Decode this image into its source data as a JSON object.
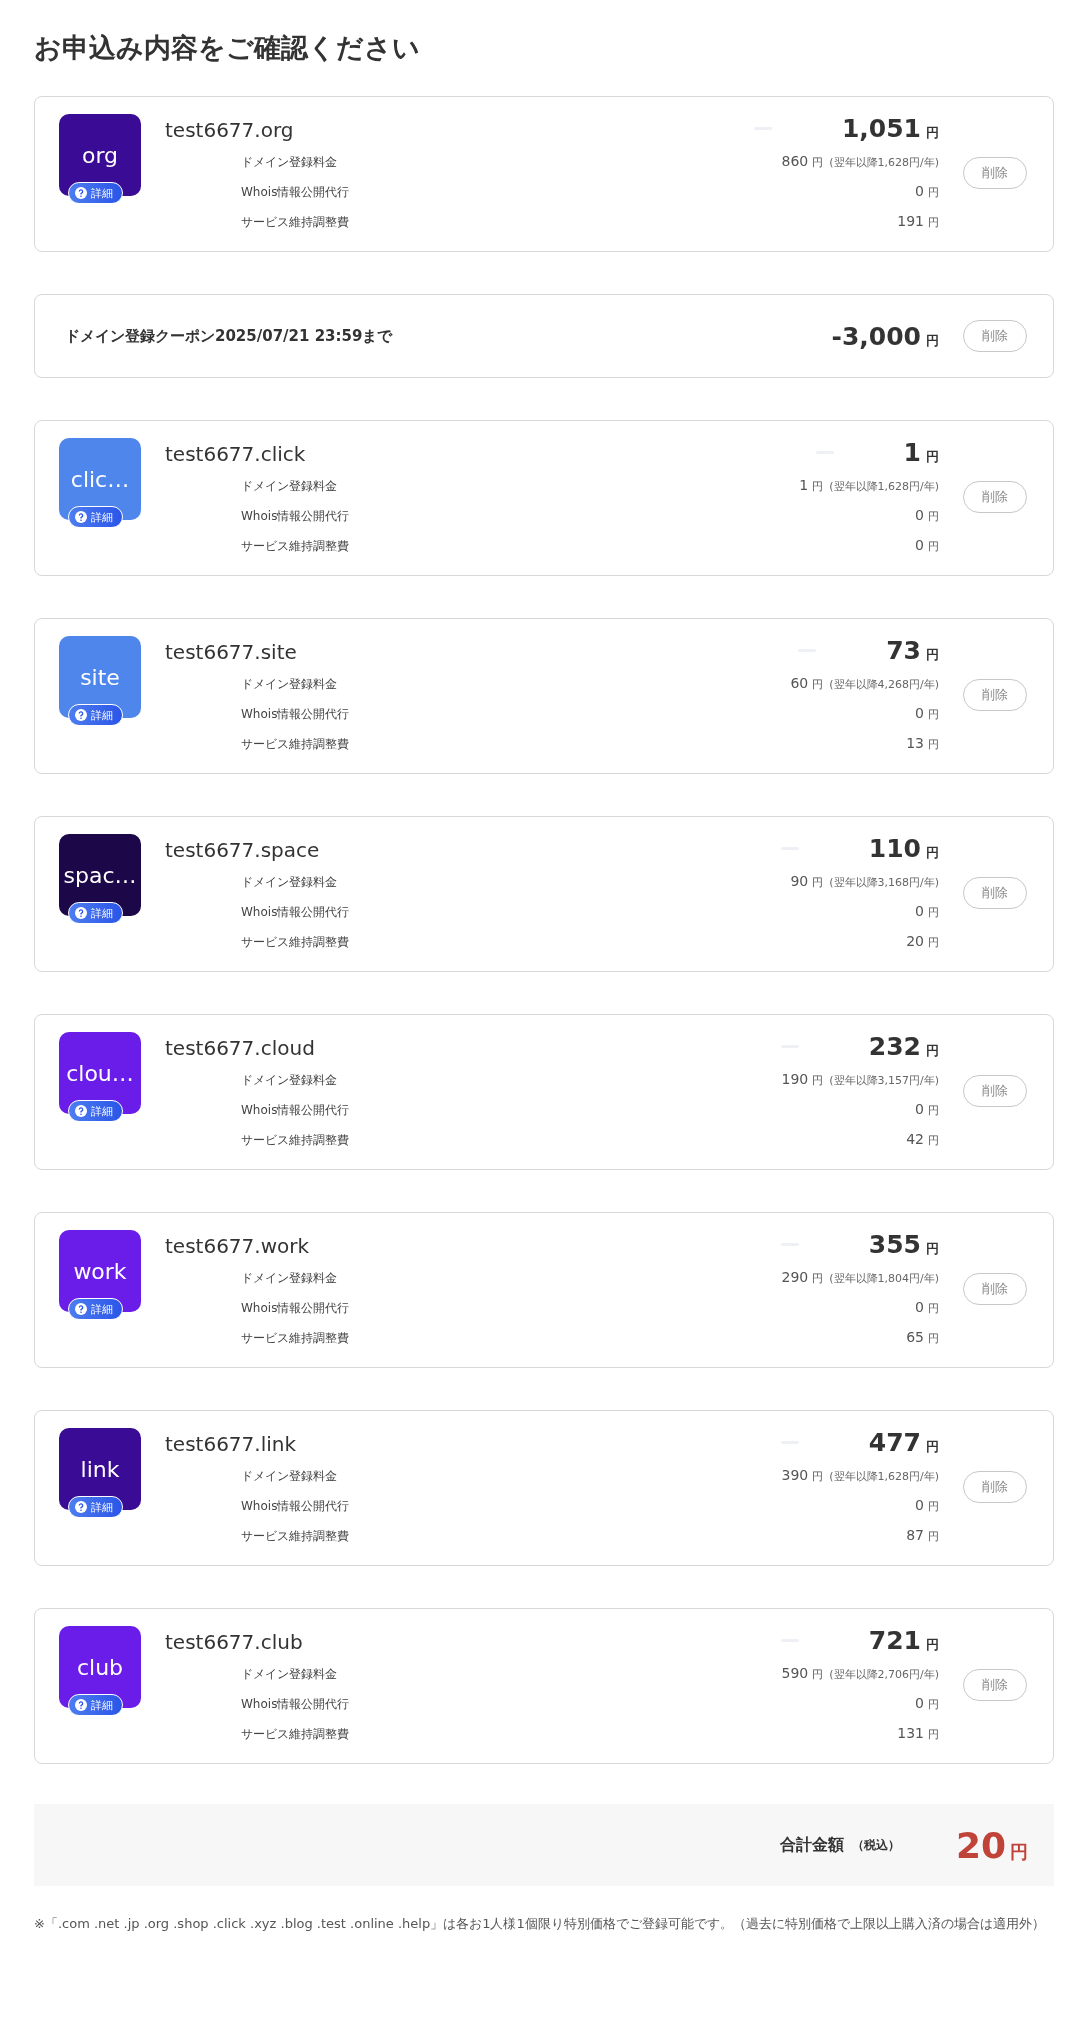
{
  "title": "お申込み内容をご確認ください",
  "items": [
    {
      "kind": "domain",
      "name": "test6677.org",
      "icon_label": "org",
      "color": "#3a0b94",
      "detail_label": "詳細",
      "price": "1,051",
      "unit": "円",
      "delete_label": "削除",
      "rows": [
        {
          "label": "ドメイン登録料金",
          "amount": "860",
          "unit": "円",
          "note": "(翌年以降1,628円/年)"
        },
        {
          "label": "Whois情報公開代行",
          "amount": "0",
          "unit": "円"
        },
        {
          "label": "サービス維持調整費",
          "amount": "191",
          "unit": "円"
        }
      ]
    },
    {
      "kind": "coupon",
      "name": "ドメイン登録クーポン2025/07/21 23:59まで",
      "price": "-3,000",
      "unit": "円",
      "delete_label": "削除"
    },
    {
      "kind": "domain",
      "name": "test6677.click",
      "icon_label": "clic…",
      "color": "#4f86ec",
      "detail_label": "詳細",
      "price": "1",
      "unit": "円",
      "delete_label": "削除",
      "rows": [
        {
          "label": "ドメイン登録料金",
          "amount": "1",
          "unit": "円",
          "note": "(翌年以降1,628円/年)"
        },
        {
          "label": "Whois情報公開代行",
          "amount": "0",
          "unit": "円"
        },
        {
          "label": "サービス維持調整費",
          "amount": "0",
          "unit": "円"
        }
      ]
    },
    {
      "kind": "domain",
      "name": "test6677.site",
      "icon_label": "site",
      "color": "#4f86ec",
      "detail_label": "詳細",
      "price": "73",
      "unit": "円",
      "delete_label": "削除",
      "rows": [
        {
          "label": "ドメイン登録料金",
          "amount": "60",
          "unit": "円",
          "note": "(翌年以降4,268円/年)"
        },
        {
          "label": "Whois情報公開代行",
          "amount": "0",
          "unit": "円"
        },
        {
          "label": "サービス維持調整費",
          "amount": "13",
          "unit": "円"
        }
      ]
    },
    {
      "kind": "domain",
      "name": "test6677.space",
      "icon_label": "spac…",
      "color": "#1c0848",
      "detail_label": "詳細",
      "price": "110",
      "unit": "円",
      "delete_label": "削除",
      "rows": [
        {
          "label": "ドメイン登録料金",
          "amount": "90",
          "unit": "円",
          "note": "(翌年以降3,168円/年)"
        },
        {
          "label": "Whois情報公開代行",
          "amount": "0",
          "unit": "円"
        },
        {
          "label": "サービス維持調整費",
          "amount": "20",
          "unit": "円"
        }
      ]
    },
    {
      "kind": "domain",
      "name": "test6677.cloud",
      "icon_label": "clou…",
      "color": "#6a1de8",
      "detail_label": "詳細",
      "price": "232",
      "unit": "円",
      "delete_label": "削除",
      "rows": [
        {
          "label": "ドメイン登録料金",
          "amount": "190",
          "unit": "円",
          "note": "(翌年以降3,157円/年)"
        },
        {
          "label": "Whois情報公開代行",
          "amount": "0",
          "unit": "円"
        },
        {
          "label": "サービス維持調整費",
          "amount": "42",
          "unit": "円"
        }
      ]
    },
    {
      "kind": "domain",
      "name": "test6677.work",
      "icon_label": "work",
      "color": "#6a1de8",
      "detail_label": "詳細",
      "price": "355",
      "unit": "円",
      "delete_label": "削除",
      "rows": [
        {
          "label": "ドメイン登録料金",
          "amount": "290",
          "unit": "円",
          "note": "(翌年以降1,804円/年)"
        },
        {
          "label": "Whois情報公開代行",
          "amount": "0",
          "unit": "円"
        },
        {
          "label": "サービス維持調整費",
          "amount": "65",
          "unit": "円"
        }
      ]
    },
    {
      "kind": "domain",
      "name": "test6677.link",
      "icon_label": "link",
      "color": "#3a0b94",
      "detail_label": "詳細",
      "price": "477",
      "unit": "円",
      "delete_label": "削除",
      "rows": [
        {
          "label": "ドメイン登録料金",
          "amount": "390",
          "unit": "円",
          "note": "(翌年以降1,628円/年)"
        },
        {
          "label": "Whois情報公開代行",
          "amount": "0",
          "unit": "円"
        },
        {
          "label": "サービス維持調整費",
          "amount": "87",
          "unit": "円"
        }
      ]
    },
    {
      "kind": "domain",
      "name": "test6677.club",
      "icon_label": "club",
      "color": "#6a1de8",
      "detail_label": "詳細",
      "price": "721",
      "unit": "円",
      "delete_label": "削除",
      "rows": [
        {
          "label": "ドメイン登録料金",
          "amount": "590",
          "unit": "円",
          "note": "(翌年以降2,706円/年)"
        },
        {
          "label": "Whois情報公開代行",
          "amount": "0",
          "unit": "円"
        },
        {
          "label": "サービス維持調整費",
          "amount": "131",
          "unit": "円"
        }
      ]
    }
  ],
  "total": {
    "label": "合計金額",
    "tax_note": "（税込）",
    "amount": "20",
    "unit": "円"
  },
  "footnote": "※「.com .net .jp .org .shop .click .xyz .blog .test .online .help」は各お1人様1個限り特別価格でご登録可能です。（過去に特別価格で上限以上購入済の場合は適用外）"
}
